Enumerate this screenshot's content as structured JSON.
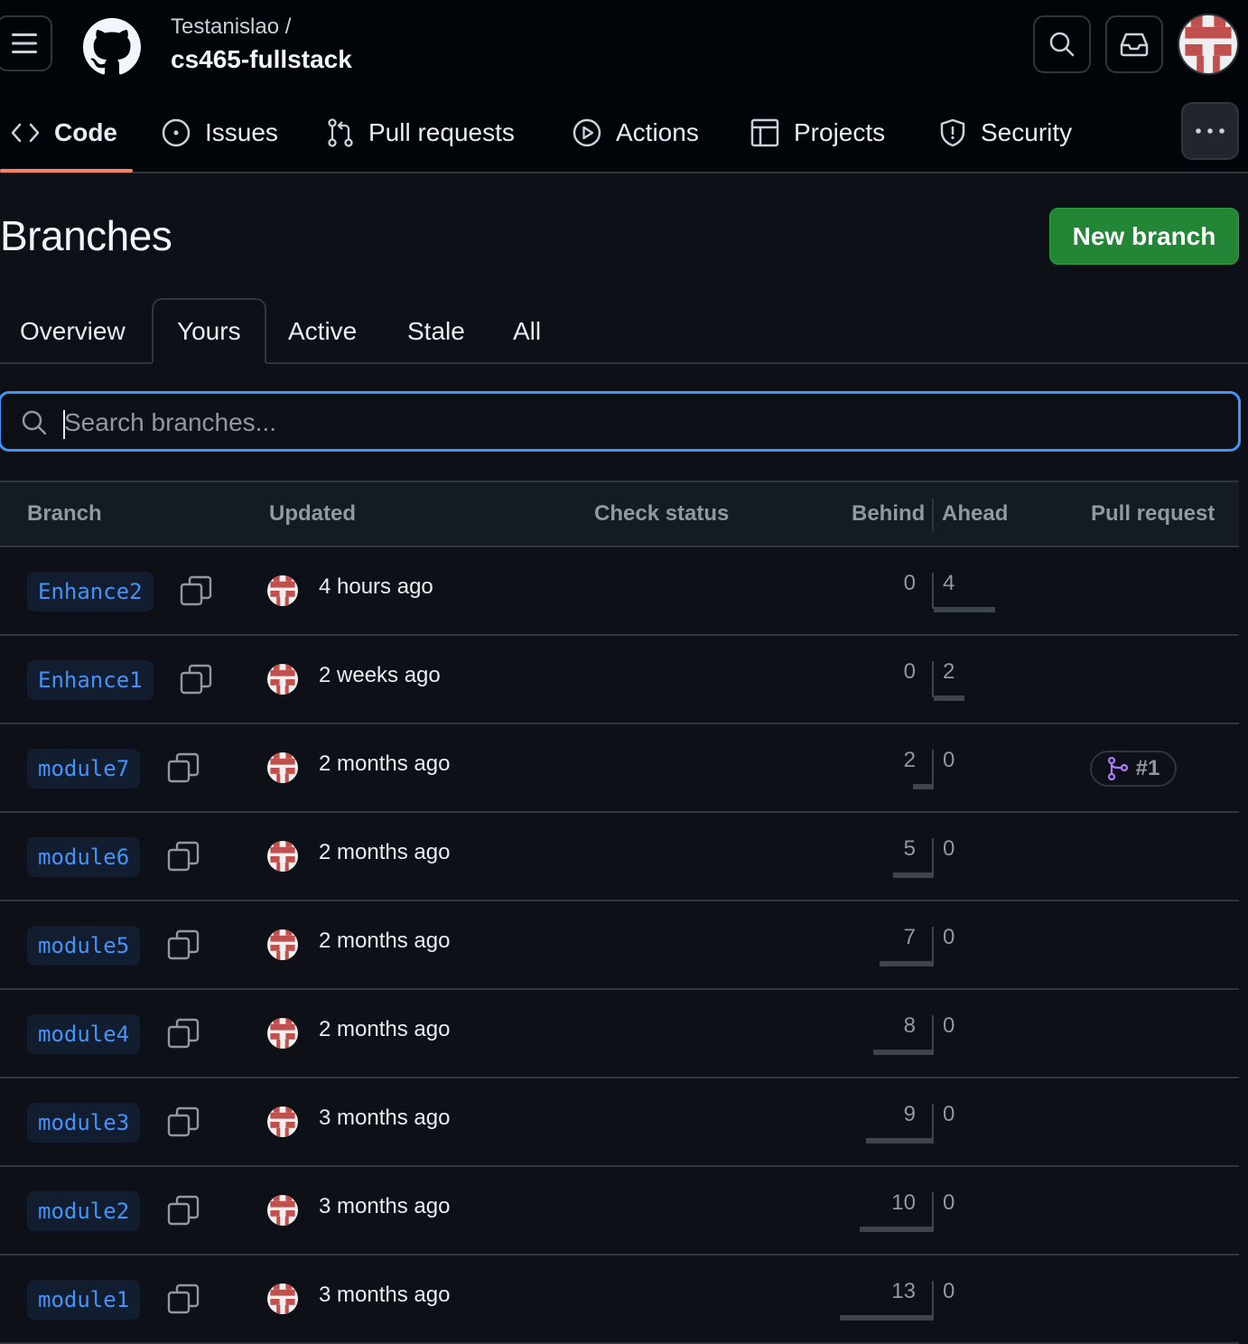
{
  "header": {
    "owner": "Testanislao /",
    "repo": "cs465-fullstack"
  },
  "nav": {
    "items": [
      {
        "label": "Code",
        "icon": "code-icon"
      },
      {
        "label": "Issues",
        "icon": "issue-opened-icon"
      },
      {
        "label": "Pull requests",
        "icon": "git-pull-request-icon"
      },
      {
        "label": "Actions",
        "icon": "play-icon"
      },
      {
        "label": "Projects",
        "icon": "table-icon"
      },
      {
        "label": "Security",
        "icon": "shield-icon"
      }
    ],
    "active": "Code"
  },
  "page": {
    "title": "Branches",
    "new_branch_label": "New branch"
  },
  "tabs": {
    "items": [
      "Overview",
      "Yours",
      "Active",
      "Stale",
      "All"
    ],
    "selected": "Yours"
  },
  "search": {
    "placeholder": "Search branches...",
    "value": ""
  },
  "table": {
    "headers": {
      "branch": "Branch",
      "updated": "Updated",
      "check_status": "Check status",
      "behind": "Behind",
      "ahead": "Ahead",
      "pull_request": "Pull request"
    },
    "rows": [
      {
        "branch": "Enhance2",
        "updated": "4 hours ago",
        "behind": "0",
        "ahead": "4",
        "pr": ""
      },
      {
        "branch": "Enhance1",
        "updated": "2 weeks ago",
        "behind": "0",
        "ahead": "2",
        "pr": ""
      },
      {
        "branch": "module7",
        "updated": "2 months ago",
        "behind": "2",
        "ahead": "0",
        "pr": "#1"
      },
      {
        "branch": "module6",
        "updated": "2 months ago",
        "behind": "5",
        "ahead": "0",
        "pr": ""
      },
      {
        "branch": "module5",
        "updated": "2 months ago",
        "behind": "7",
        "ahead": "0",
        "pr": ""
      },
      {
        "branch": "module4",
        "updated": "2 months ago",
        "behind": "8",
        "ahead": "0",
        "pr": ""
      },
      {
        "branch": "module3",
        "updated": "3 months ago",
        "behind": "9",
        "ahead": "0",
        "pr": ""
      },
      {
        "branch": "module2",
        "updated": "3 months ago",
        "behind": "10",
        "ahead": "0",
        "pr": ""
      },
      {
        "branch": "module1",
        "updated": "3 months ago",
        "behind": "13",
        "ahead": "0",
        "pr": ""
      }
    ]
  },
  "colors": {
    "background": "#0d1117",
    "header_bg": "#010409",
    "accent_blue": "#4493f8",
    "primary_green": "#238636",
    "underline": "#f78166",
    "pr_purple": "#ab7df8"
  }
}
